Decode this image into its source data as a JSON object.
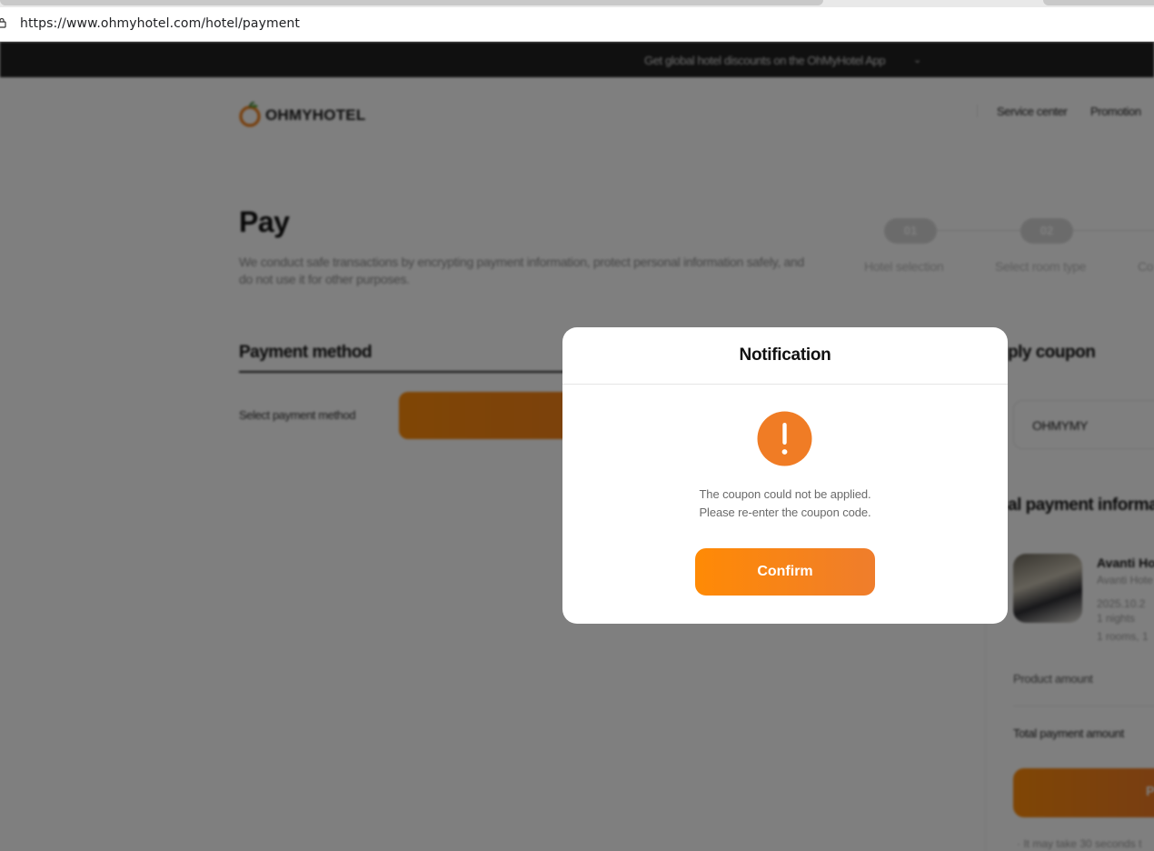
{
  "browser": {
    "url": "https://www.ohmyhotel.com/hotel/payment"
  },
  "banner": {
    "text": "Get global hotel discounts on the OhMyHotel App",
    "chevron": "⌄"
  },
  "header": {
    "logo_text": "OHMYHOTEL",
    "nav": [
      "Service center",
      "Promotion"
    ]
  },
  "pay": {
    "title": "Pay",
    "description": "We conduct safe transactions by encrypting payment information, protect personal information safely, and do not use it for other purposes."
  },
  "steps": [
    {
      "num": "01",
      "label": "Hotel selection"
    },
    {
      "num": "02",
      "label": "Select room type"
    },
    {
      "num": "",
      "label": "Co"
    }
  ],
  "payment_method": {
    "title": "Payment method",
    "label": "Select payment method"
  },
  "coupon": {
    "title": "ply coupon",
    "code": "OHMYMY"
  },
  "payment_info": {
    "title": "al payment informa",
    "hotel_name": "Avanti Ho",
    "hotel_sub": "Avanti Hote",
    "date": "2025.10.2",
    "nights": "1 nights",
    "rooms": "1 rooms, 1",
    "product_amount_label": "Product amount",
    "total_amount_label": "Total payment amount",
    "pay_button": "P",
    "footnote": "· It may take 30 seconds t"
  },
  "modal": {
    "title": "Notification",
    "message_line1": "The coupon could not be applied.",
    "message_line2": "Please re-enter the coupon code.",
    "confirm_label": "Confirm"
  },
  "colors": {
    "accent": "#f6821f",
    "overlay": "rgba(0,0,0,0.5)",
    "banner": "#202020"
  }
}
